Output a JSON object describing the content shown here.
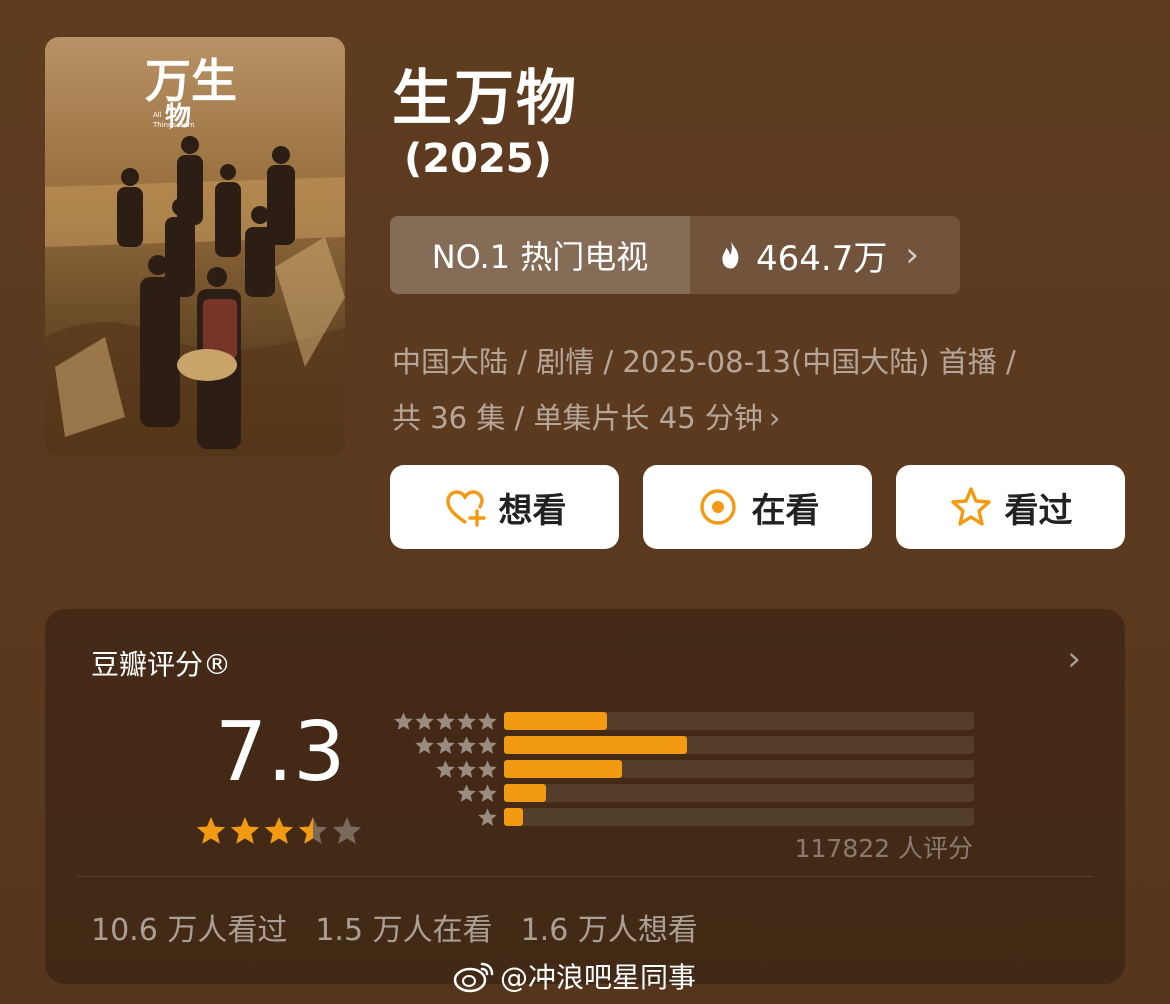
{
  "poster": {
    "logo_text": "万生物",
    "logo_subtitle": "All Things Born"
  },
  "title": "生万物",
  "year": "(2025)",
  "rank": {
    "label": "NO.1 热门电视",
    "heat": "464.7万",
    "icon": "fire-icon"
  },
  "meta": {
    "line1": "中国大陆 / 剧情 / 2025-08-13(中国大陆) 首播 /",
    "line2": "共 36 集 / 单集片长 45 分钟"
  },
  "actions": {
    "want": "想看",
    "watching": "在看",
    "watched": "看过"
  },
  "rating": {
    "title": "豆瓣评分®",
    "score": "7.3",
    "stars": 3.5,
    "distribution": [
      {
        "stars": 5,
        "fraction": 0.22
      },
      {
        "stars": 4,
        "fraction": 0.39
      },
      {
        "stars": 3,
        "fraction": 0.25
      },
      {
        "stars": 2,
        "fraction": 0.09
      },
      {
        "stars": 1,
        "fraction": 0.04
      }
    ],
    "vote_count": "117822 人评分",
    "stats": [
      "10.6 万人看过",
      "1.5 万人在看",
      "1.6 万人想看"
    ]
  },
  "colors": {
    "accent": "#f29a12",
    "background": "#5c3a1f"
  },
  "watermark": "@冲浪吧星同事"
}
